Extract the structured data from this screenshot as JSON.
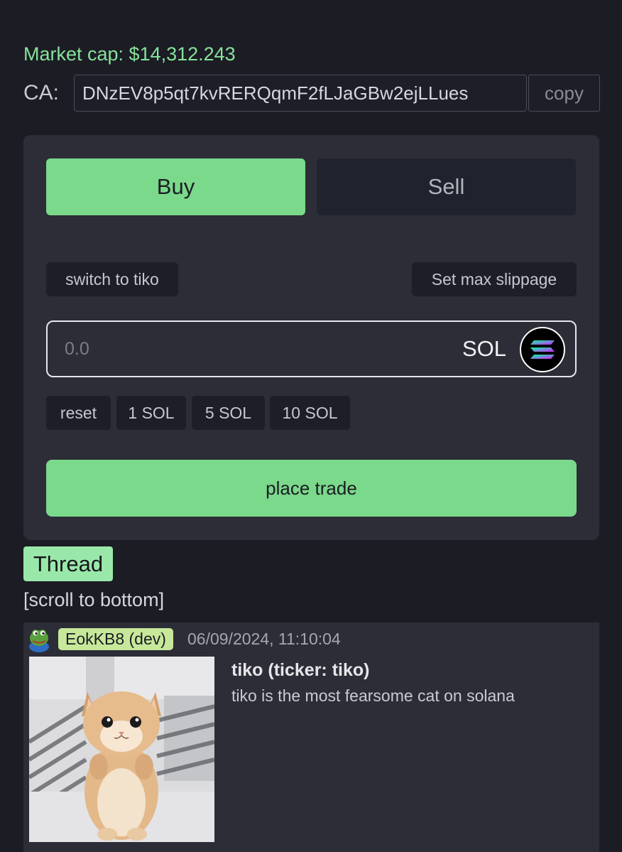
{
  "header": {
    "market_cap": "Market cap: $14,312.243",
    "ca_label": "CA:",
    "ca_value": "DNzEV8p5qt7kvRERQqmF2fLJaGBw2ejLLues",
    "copy_label": "copy"
  },
  "trade": {
    "tabs": {
      "buy_label": "Buy",
      "sell_label": "Sell",
      "active": "Buy"
    },
    "switch_label": "switch to tiko",
    "slippage_label": "Set max slippage",
    "amount_placeholder": "0.0",
    "currency_label": "SOL",
    "currency_icon": "solana-icon",
    "presets": [
      "reset",
      "1 SOL",
      "5 SOL",
      "10 SOL"
    ],
    "place_trade_label": "place trade"
  },
  "thread": {
    "title": "Thread",
    "scroll_label": "[scroll to bottom]",
    "posts": [
      {
        "author_badge": "EokKB8 (dev)",
        "timestamp": "06/09/2024, 11:10:04",
        "title": "tiko (ticker: tiko)",
        "description": "tiko is the most fearsome cat on solana",
        "avatar_icon": "frog-avatar-icon",
        "image_name": "kitten-image"
      }
    ]
  },
  "colors": {
    "background": "#1c1c25",
    "panel": "#2c2d37",
    "accent_green": "#7ad98a",
    "market_cap_green": "#86e39a",
    "dev_badge": "#c7e89a"
  }
}
